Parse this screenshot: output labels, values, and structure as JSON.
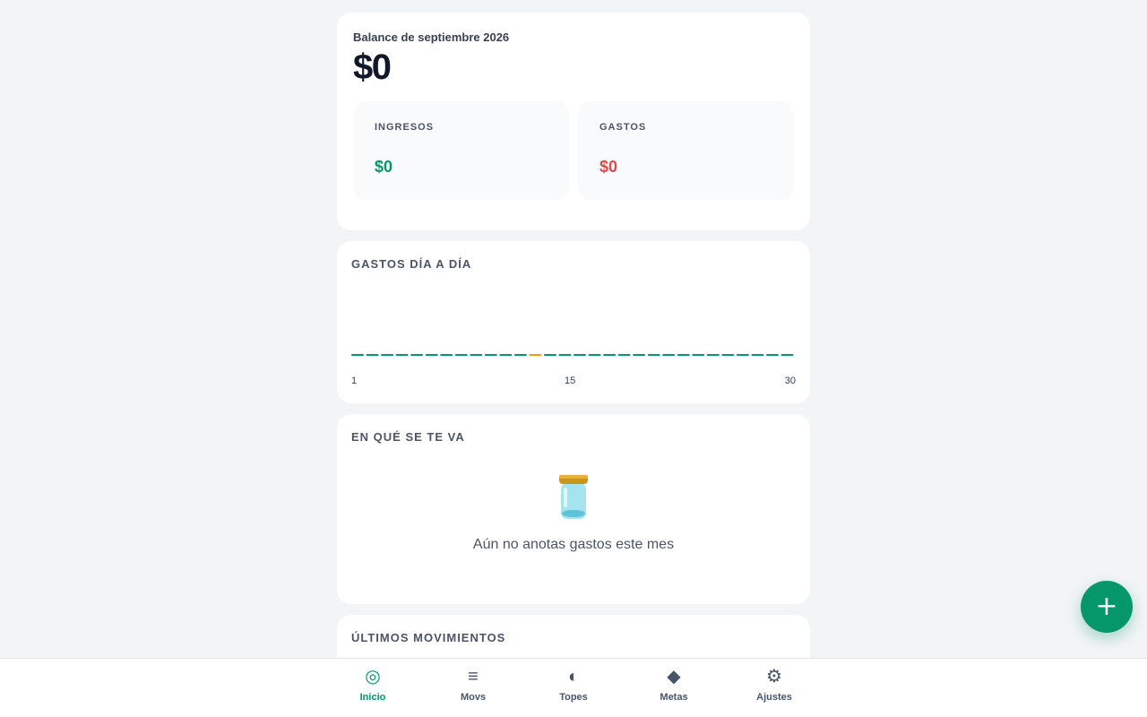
{
  "balance": {
    "title": "Balance de septiembre 2026",
    "amount": "$0",
    "income_label": "INGRESOS",
    "income_value": "$0",
    "expense_label": "GASTOS",
    "expense_value": "$0"
  },
  "daily": {
    "title": "GASTOS DÍA A DÍA",
    "chart_data": {
      "type": "bar",
      "days": 30,
      "values": [
        0,
        0,
        0,
        0,
        0,
        0,
        0,
        0,
        0,
        0,
        0,
        0,
        0,
        0,
        0,
        0,
        0,
        0,
        0,
        0,
        0,
        0,
        0,
        0,
        0,
        0,
        0,
        0,
        0,
        0
      ],
      "highlight_day": 13,
      "tick_labels": [
        "1",
        "15",
        "30"
      ],
      "bar_color": "#059669",
      "highlight_color": "#f59e0b"
    }
  },
  "categories": {
    "title": "EN QUÉ SE TE VA",
    "empty_icon": "jar-icon",
    "empty_text": "Aún no anotas gastos este mes"
  },
  "moves": {
    "title": "ÚLTIMOS MOVIMIENTOS"
  },
  "nav": {
    "items": [
      {
        "label": "Inicio",
        "icon": "◎"
      },
      {
        "label": "Movs",
        "icon": "≡"
      },
      {
        "label": "Topes",
        "icon": "◐"
      },
      {
        "label": "Metas",
        "icon": "◆"
      },
      {
        "label": "Ajustes",
        "icon": "⚙"
      }
    ]
  },
  "fab": {
    "icon": "+"
  },
  "colors": {
    "accent": "#059669",
    "expense": "#dc4a4a",
    "background": "#f3f4f6"
  }
}
